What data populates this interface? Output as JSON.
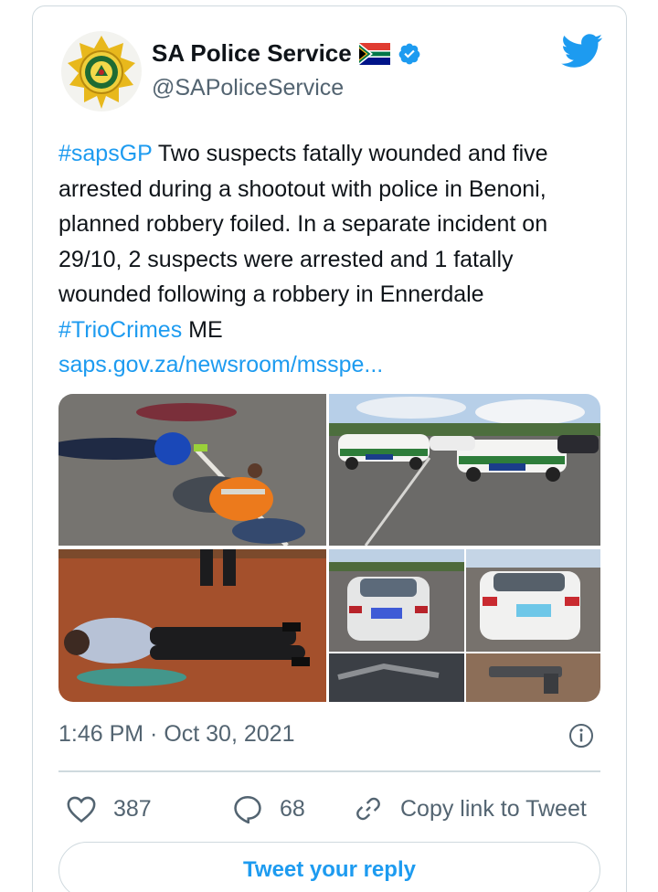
{
  "author": {
    "display_name": "SA Police Service",
    "handle": "@SAPoliceService",
    "verified": true,
    "avatar_icon": "saps-badge-icon",
    "flag_icon": "south-africa-flag-icon"
  },
  "tweet": {
    "hashtag1": "#sapsGP",
    "body1": " Two suspects fatally wounded and five arrested during a shootout with police in Benoni, planned robbery foiled. In a separate incident on 29/10, 2 suspects were arrested and 1 fatally wounded following a robbery in Ennerdale ",
    "hashtag2": "#TrioCrimes",
    "body2": " ME",
    "link": "saps.gov.za/newsroom/msspe..."
  },
  "media": {
    "images": [
      {
        "id": "suspects-on-road"
      },
      {
        "id": "police-vehicles"
      },
      {
        "id": "suspect-on-ground"
      },
      {
        "id": "cars-and-firearms"
      }
    ]
  },
  "meta": {
    "timestamp": "1:46 PM · Oct 30, 2021"
  },
  "actions": {
    "likes": "387",
    "replies": "68",
    "copy_link_label": "Copy link to Tweet"
  },
  "reply_button_label": "Tweet your reply",
  "colors": {
    "accent": "#1d9bf0",
    "text": "#0f1419",
    "muted": "#536471",
    "border": "#cfd9de"
  }
}
